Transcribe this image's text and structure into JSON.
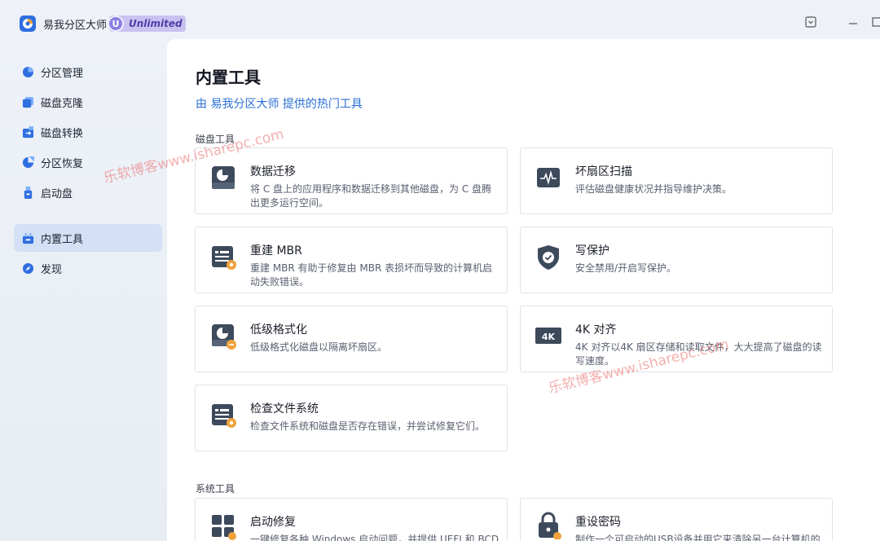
{
  "app": {
    "title": "易我分区大师",
    "badge_letter": "U",
    "badge_text": "Unlimited"
  },
  "sidebar": {
    "items": [
      {
        "label": "分区管理",
        "icon": "pie-chart-icon"
      },
      {
        "label": "磁盘克隆",
        "icon": "clone-icon"
      },
      {
        "label": "磁盘转换",
        "icon": "convert-icon"
      },
      {
        "label": "分区恢复",
        "icon": "recovery-icon"
      },
      {
        "label": "启动盘",
        "icon": "usb-icon"
      },
      {
        "label": "内置工具",
        "icon": "toolbox-icon",
        "active": true
      },
      {
        "label": "发现",
        "icon": "compass-icon"
      }
    ]
  },
  "main": {
    "title": "内置工具",
    "subtitle": "由 易我分区大师 提供的热门工具",
    "disk_tools_label": "磁盘工具",
    "system_tools_label": "系统工具",
    "disk_tools": [
      {
        "title": "数据迁移",
        "desc": "将 C 盘上的应用程序和数据迁移到其他磁盘，为 C 盘腾出更多运行空间。",
        "icon": "data-migration-icon"
      },
      {
        "title": "坏扇区扫描",
        "desc": "评估磁盘健康状况并指导维护决策。",
        "icon": "bad-sector-scan-icon"
      },
      {
        "title": "重建 MBR",
        "desc": "重建 MBR 有助于修复由 MBR 表损坏而导致的计算机启动失败错误。",
        "icon": "rebuild-mbr-icon"
      },
      {
        "title": "写保护",
        "desc": "安全禁用/开启写保护。",
        "icon": "write-protect-icon"
      },
      {
        "title": "低级格式化",
        "desc": "低级格式化磁盘以隔离坏扇区。",
        "icon": "low-level-format-icon"
      },
      {
        "title": "4K 对齐",
        "desc": "4K 对齐以4K 扇区存储和读取文件，大大提高了磁盘的读写速度。",
        "icon": "4k-align-icon"
      },
      {
        "title": "检查文件系统",
        "desc": "检查文件系统和磁盘是否存在错误，并尝试修复它们。",
        "icon": "check-filesystem-icon"
      }
    ],
    "system_tools": [
      {
        "title": "启动修复",
        "desc": "一键修复各种 Windows 启动问题，并提供 UEFI 和 BCD",
        "icon": "boot-repair-icon"
      },
      {
        "title": "重设密码",
        "desc": "制作一个可启动的USB设备并用它来清除另一台计算机的",
        "icon": "reset-password-icon"
      }
    ]
  },
  "watermarks": [
    "乐软博客www.isharepc.com",
    "乐软博客www.isharepc.com"
  ],
  "colors": {
    "accent": "#2a6fd4",
    "active_nav_bg": "#d3e0f5",
    "icon_dark": "#3d4a5c",
    "icon_orange": "#f0a23b"
  }
}
